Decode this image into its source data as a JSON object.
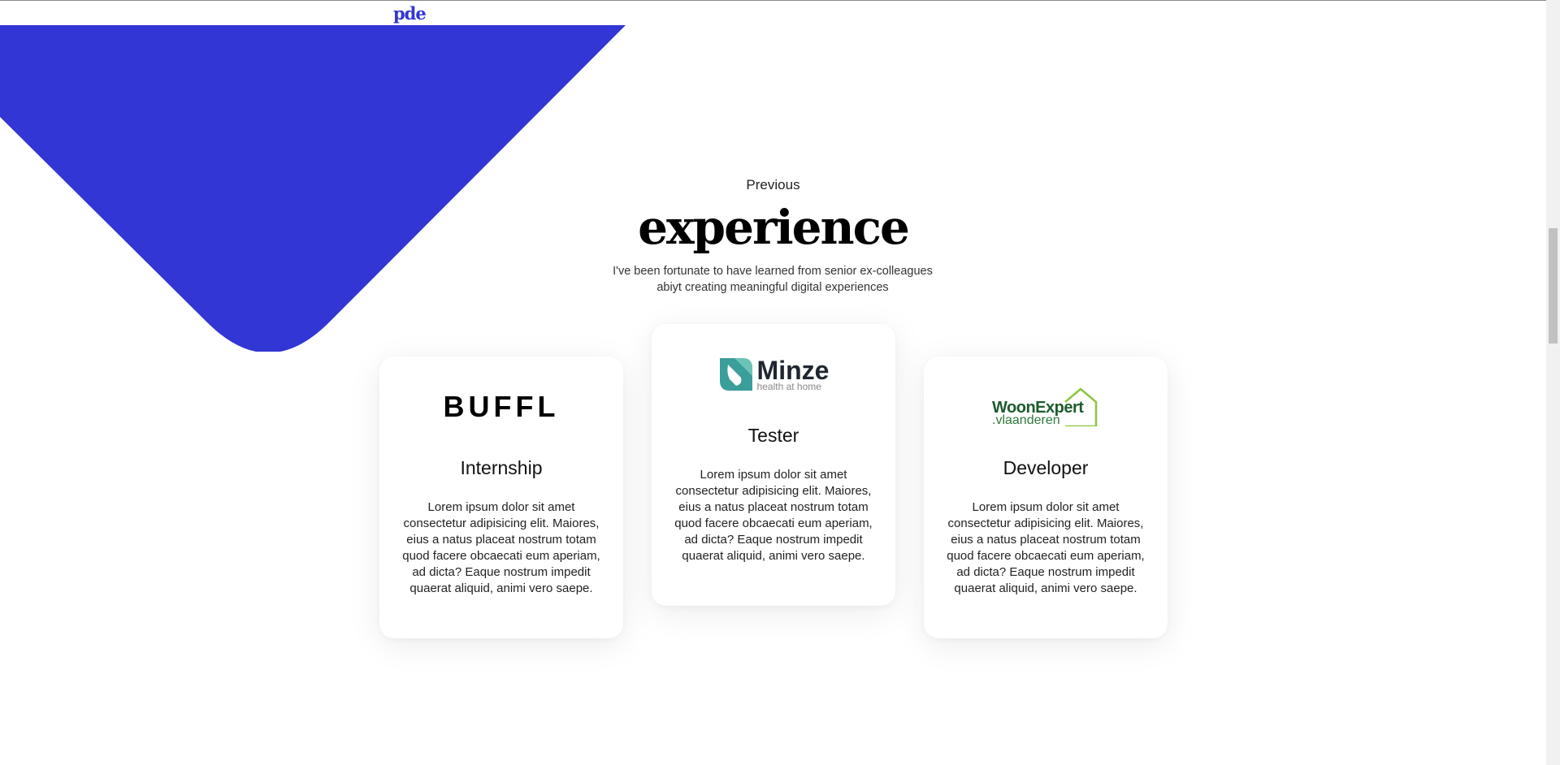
{
  "nav": {
    "logo": "pde"
  },
  "section": {
    "eyebrow": "Previous",
    "title": "experience",
    "subtitle": "I've been fortunate to have learned from senior ex-colleagues abiyt creating meaningful digital experiences"
  },
  "cards": [
    {
      "company": "BUFFL",
      "role": "Internship",
      "text": "Lorem ipsum dolor sit amet consectetur adipisicing elit. Maiores, eius a natus placeat nostrum totam quod facere obcaecati eum aperiam, ad dicta? Eaque nostrum impedit quaerat aliquid, animi vero saepe."
    },
    {
      "company": "Minze",
      "tagline": "health at home",
      "role": "Tester",
      "text": "Lorem ipsum dolor sit amet consectetur adipisicing elit. Maiores, eius a natus placeat nostrum totam quod facere obcaecati eum aperiam, ad dicta? Eaque nostrum impedit quaerat aliquid, animi vero saepe."
    },
    {
      "company": "WoonExpert",
      "company_sub": ".vlaanderen",
      "role": "Developer",
      "text": "Lorem ipsum dolor sit amet consectetur adipisicing elit. Maiores, eius a natus placeat nostrum totam quod facere obcaecati eum aperiam, ad dicta? Eaque nostrum impedit quaerat aliquid, animi vero saepe."
    }
  ],
  "colors": {
    "accent": "#3236d4",
    "minze_teal": "#3a9e9b",
    "woon_green": "#1d5b2c",
    "woon_lime": "#8cc63f"
  }
}
